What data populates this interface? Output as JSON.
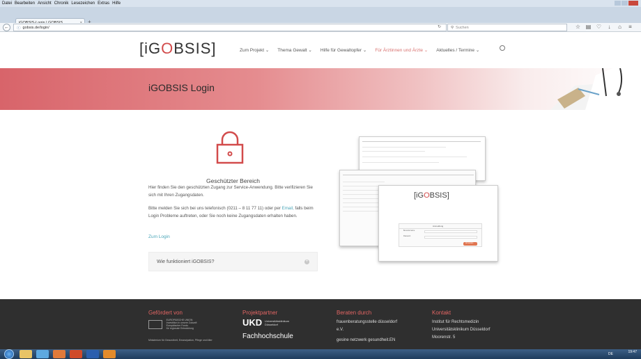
{
  "browser": {
    "menu": [
      "Datei",
      "Bearbeiten",
      "Ansicht",
      "Chronik",
      "Lesezeichen",
      "Extras",
      "Hilfe"
    ],
    "tab_title": "iGOBSIS-Login | GOBSIS",
    "url": "gobsis.de/login/",
    "search_placeholder": "Suchen"
  },
  "site": {
    "logo": {
      "left": "[iG",
      "o": "O",
      "right": "BSIS]"
    },
    "nav": [
      {
        "label": "Zum Projekt ⌄",
        "active": false
      },
      {
        "label": "Thema Gewalt ⌄",
        "active": false
      },
      {
        "label": "Hilfe für Gewaltopfer ⌄",
        "active": false
      },
      {
        "label": "Für Ärztinnen und Ärzte ⌄",
        "active": true
      },
      {
        "label": "Aktuelles / Termine ⌄",
        "active": false
      }
    ],
    "banner_title": "iGOBSIS Login"
  },
  "main": {
    "section_title": "Geschützter Bereich",
    "para1": "Hier finden Sie den geschützten Zugang zur Service-Anwendung. Bitte verifizieren Sie sich mit Ihren Zugangsdaten.",
    "para2_before": "Bitte melden Sie sich bei uns telefonisch (0211 – 8 11 77 11) oder per ",
    "para2_link": "Email,",
    "para2_after": " falls beim Login Probleme auftreten, oder Sie noch keine Zugangsdaten erhalten haben.",
    "login_link": "Zum Login",
    "faq_label": "Wie funktioniert iGOBSIS?",
    "screenshot": {
      "logo_left": "[iG",
      "logo_o": "O",
      "logo_right": "BSIS]",
      "login_header": "Anmeldung",
      "user_label": "Benutzername",
      "pass_label": "Passwort",
      "button": "Anmelden"
    }
  },
  "footer": {
    "funded": {
      "heading": "Gefördert von",
      "eu_text": "EUROPÄISCHE UNION\nInvestition in unsere Zukunft\nEuropäischer Fonds\nfür regionale Entwicklung",
      "ministry": "Ministerium für Gesundheit, Emanzipation, Pflege und Alter"
    },
    "partners": {
      "heading": "Projektpartner",
      "ukd": "UKD",
      "ukd_sub": "Universitätsklinikum\nDüsseldorf",
      "fh": "Fachhochschule"
    },
    "advised": {
      "heading": "Beraten durch",
      "line1": "frauenberatungsstelle düsseldorf",
      "line2": "e.V.",
      "line3": "gesine netzwerk gesundheit.EN"
    },
    "contact": {
      "heading": "Kontakt",
      "line1": "Institut für Rechtsmedizin",
      "line2": "Universitätsklinikum Düsseldorf",
      "line3": "Moorenstr. 5"
    }
  },
  "taskbar": {
    "lang": "DE",
    "time": "19:47"
  },
  "colors": {
    "accent": "#d24b4b",
    "link": "#4aa6b8",
    "footer_bg": "#2f2f2f"
  }
}
